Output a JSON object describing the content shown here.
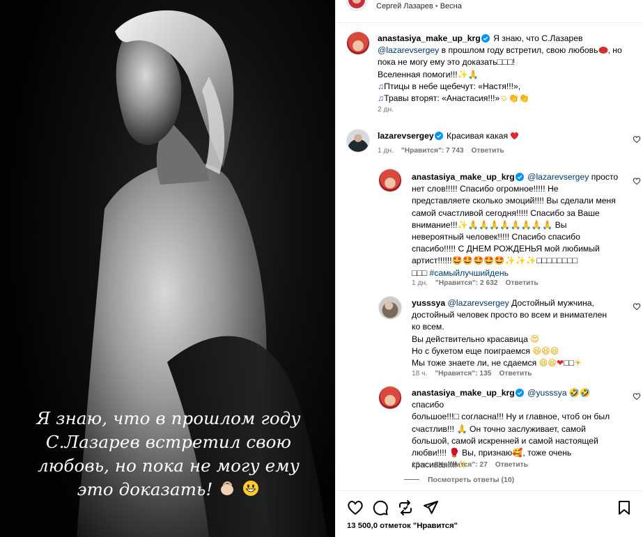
{
  "post": {
    "image_caption_lines": [
      "Я знаю, что в прошлом году",
      "С.Лазарев встретил свою",
      "любовь, но пока не могу ему",
      "это доказать!"
    ],
    "header_author": "Сергей Лазарев",
    "header_separator": "•",
    "header_audio": "Весна"
  },
  "caption": {
    "username": "anastasiya_make_up_krg",
    "line1": " Я знаю, что С.Лазарев",
    "mention": "@lazarevsergey",
    "line2": " в прошлом году встретил, свою любовь",
    "line2b": ", но",
    "line3": "пока не могу ему это доказать",
    "line3b": "!",
    "line4": "Вселенная помоги!!!",
    "line5": "Птицы в небе щебечут: «Настя!!!»,",
    "line6": "Травы вторят: «Анастасия!!!»",
    "time": "2 дн."
  },
  "comments": [
    {
      "username": "lazarevsergey",
      "text": " Красивая какая ",
      "time": "1 дн.",
      "likes": "\"Нравится\": 7 743",
      "reply": "Ответить"
    },
    {
      "username": "anastasiya_make_up_krg",
      "mention": "@lazarevsergey",
      "lines": [
        " просто",
        "нет слов!!!!! Спасибо огромное!!!!! Не",
        "представляете сколько эмоций!!!! Вы сделали меня",
        "самой счастливой сегодня!!!!! Спасибо за Ваше",
        "внимание!!!",
        "невероятный человек!!!!! Спасибо спасибо",
        "спасибо!!!!! С ДНЕМ РОЖДЕНЬЯ мой любимый",
        "артист!!!!!!"
      ],
      "hashtag": "#самыйлучшийдень",
      "time": "1 дн.",
      "likes": "\"Нравится\": 2 632",
      "reply": "Ответить"
    },
    {
      "username": "yusssya",
      "mention": "@lazarevsergey",
      "lines": [
        " Достойный мужчина,",
        "достойный человек просто во всем и внимателен",
        "ко всем.",
        "Вы действительно красавица",
        "Но с букетом еще поиграемся",
        "Мы тоже знаете ли, не сдаемся"
      ],
      "time": "18 ч.",
      "likes": "\"Нравится\": 135",
      "reply": "Ответить"
    },
    {
      "username": "anastasiya_make_up_krg",
      "mention": "@yusssya",
      "lines": [
        " спасибо",
        "большое!!!",
        " согласна!!! Ну и главное, чтоб он был",
        "счастлив!!!",
        " Он точно заслуживает, самой",
        "большой, самой искренней и самой настоящей",
        "любви!!!!",
        " Вы, признаю",
        ", тоже очень",
        "красивая!!!!"
      ],
      "time": "18 ч.",
      "likes": "\"Нравится\": 27",
      "reply": "Ответить"
    }
  ],
  "view_replies": "Посмотреть ответы (10)",
  "likes_total": "13 500,0 отметок \"Нравится\"",
  "icons": [
    "heart-icon",
    "comment-icon",
    "repost-icon",
    "share-icon",
    "bookmark-icon",
    "verified-icon"
  ],
  "colors": {
    "link": "#00376b",
    "verified": "#0095f6",
    "muted": "#737373",
    "heart": "#ed1c24"
  }
}
